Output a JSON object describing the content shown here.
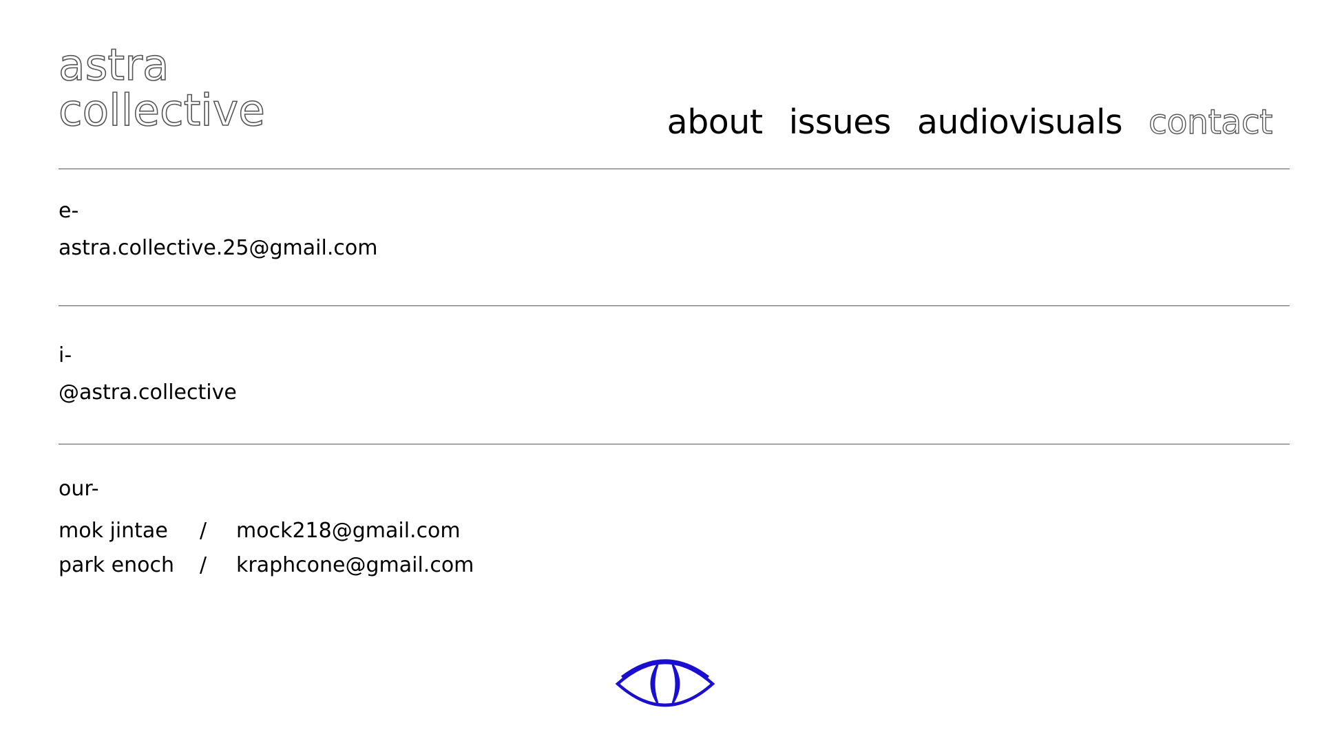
{
  "logo": {
    "line1": "astra",
    "line2": "collective"
  },
  "nav": {
    "items": [
      {
        "label": "about"
      },
      {
        "label": "issues"
      },
      {
        "label": "audiovisuals"
      },
      {
        "label": "contact"
      }
    ],
    "active": "contact"
  },
  "email_section": {
    "label": "e-",
    "value": "astra.collective.25@gmail.com"
  },
  "instagram_section": {
    "label": "i-",
    "value": "@astra.collective"
  },
  "members_section": {
    "label": "our-",
    "members": [
      {
        "name": "mok jintae",
        "separator": "/",
        "email": "mock218@gmail.com"
      },
      {
        "name": "park enoch",
        "separator": "/",
        "email": "kraphcone@gmail.com"
      }
    ]
  },
  "footer": {
    "icon": "eye-icon",
    "icon_color": "#1a0fd1"
  },
  "colors": {
    "text": "#000000",
    "outline": "#555555",
    "accent": "#1a0fd1"
  }
}
